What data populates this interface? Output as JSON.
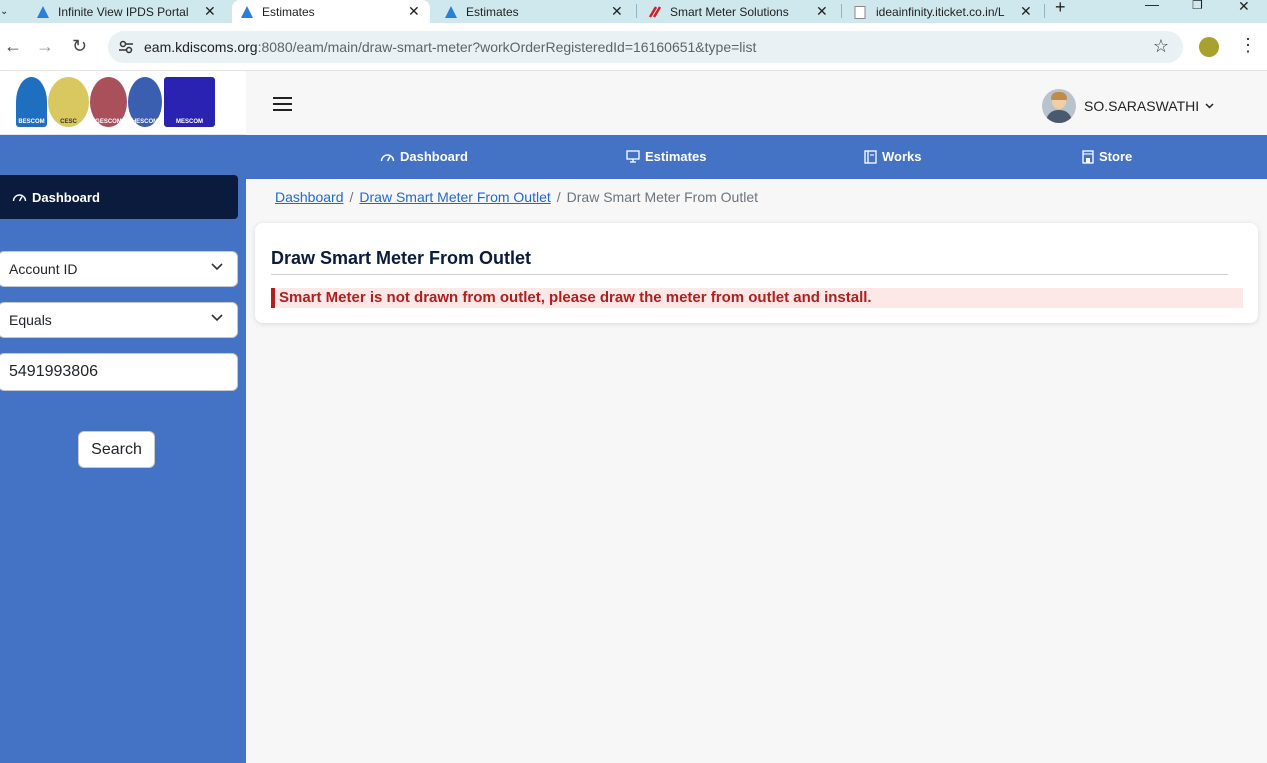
{
  "browser": {
    "tabs": [
      {
        "title": "Infinite View IPDS Portal",
        "icon": "app-icon",
        "active": false
      },
      {
        "title": "Estimates",
        "icon": "app-icon",
        "active": true
      },
      {
        "title": "Estimates",
        "icon": "app-icon",
        "active": false
      },
      {
        "title": "Smart Meter Solutions",
        "icon": "brand-icon",
        "active": false
      },
      {
        "title": "ideainfinity.iticket.co.in/L",
        "icon": "page-icon",
        "active": false
      }
    ],
    "new_tab_label": "+",
    "close_glyph": "✕",
    "window_controls": {
      "minimize": "—",
      "restore": "❐",
      "close": "✕"
    },
    "address": {
      "host": "eam.kdiscoms.org",
      "path": ":8080/eam/main/draw-smart-meter?workOrderRegisteredId=16160651&type=list"
    },
    "nav": {
      "back": "←",
      "forward": "→",
      "reload": "↻",
      "star": "☆",
      "menu": "⋮"
    }
  },
  "logos": [
    {
      "label": "BESCOM",
      "color": "#1f6fc1"
    },
    {
      "label": "CESC",
      "color": "#c9b44a"
    },
    {
      "label": "GESCOM",
      "color": "#8f3a46"
    },
    {
      "label": "HESCOM",
      "color": "#2b4e9b"
    },
    {
      "label": "MESCOM",
      "color": "#2a22b0"
    }
  ],
  "sidebar": {
    "dashboard_label": "Dashboard",
    "filter_field": "Account ID",
    "filter_operator": "Equals",
    "filter_value": "5491993806",
    "search_label": "Search"
  },
  "header": {
    "user_name": "SO.SARASWATHI"
  },
  "navbar": {
    "items": [
      {
        "label": "Dashboard",
        "icon": "dashboard-icon"
      },
      {
        "label": "Estimates",
        "icon": "monitor-icon"
      },
      {
        "label": "Works",
        "icon": "book-icon"
      },
      {
        "label": "Store",
        "icon": "store-icon"
      }
    ]
  },
  "breadcrumb": {
    "items": [
      "Dashboard",
      "Draw Smart Meter From Outlet",
      "Draw Smart Meter From Outlet"
    ],
    "separator": "/"
  },
  "card": {
    "title": "Draw Smart Meter From Outlet",
    "alert": "Smart Meter is not drawn from outlet, please draw the meter from outlet and install."
  },
  "colors": {
    "primary": "#4472c4",
    "dark_navy": "#0a1b3d",
    "alert_red": "#b21d1d",
    "alert_bg": "#fde8e8",
    "link": "#1a6ad8"
  }
}
